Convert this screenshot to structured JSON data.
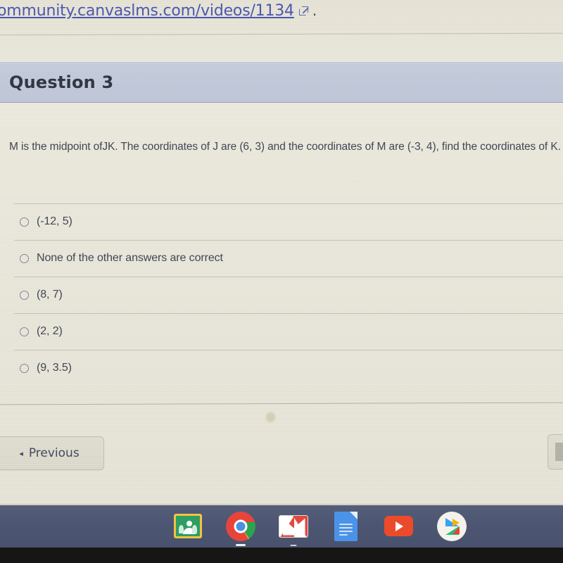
{
  "browser": {
    "url_text": "ommunity.canvaslms.com/videos/1134",
    "external_link_icon": "external-link-icon",
    "trailing_period": "."
  },
  "question": {
    "header_title": "Question 3",
    "body_text": "M is the midpoint ofJK. The coordinates of J are (6, 3) and the coordinates of M are (-3, 4), find the coordinates of K.",
    "options": [
      {
        "label": "(-12, 5)",
        "selected": false
      },
      {
        "label": "None of the other answers are correct",
        "selected": false
      },
      {
        "label": "(8, 7)",
        "selected": false
      },
      {
        "label": "(2, 2)",
        "selected": false
      },
      {
        "label": "(9, 3.5)",
        "selected": false
      }
    ]
  },
  "footer": {
    "previous_label": "Previous",
    "previous_arrow": "◂",
    "next_label": ""
  },
  "shelf": {
    "items": [
      {
        "name": "google-classroom-icon",
        "running": false
      },
      {
        "name": "chrome-icon",
        "running": true
      },
      {
        "name": "gmail-icon",
        "running": true
      },
      {
        "name": "google-docs-icon",
        "running": false
      },
      {
        "name": "youtube-icon",
        "running": false
      },
      {
        "name": "google-play-icon",
        "running": false
      }
    ]
  },
  "colors": {
    "page_background": "#e9e7da",
    "header_band": "#c2cada",
    "link": "#4a56b0",
    "text": "#3e4553",
    "shelf": "#4d5672"
  }
}
